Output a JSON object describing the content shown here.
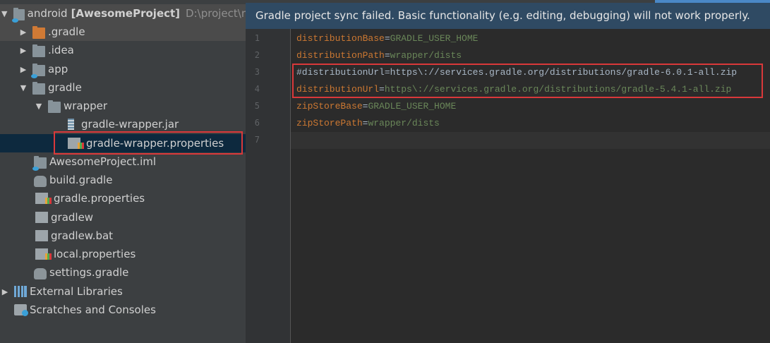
{
  "project_tree": {
    "root": {
      "name": "android",
      "module": "[AwesomeProject]",
      "path": "D:\\project\\r"
    },
    "items": [
      {
        "label": "android",
        "bold": "[AwesomeProject]",
        "path": "D:\\project\\r",
        "icon": "folder-module-icon",
        "arrow": "▼"
      },
      {
        "label": ".gradle",
        "icon": "folder-orange-icon",
        "arrow": "▶"
      },
      {
        "label": ".idea",
        "icon": "folder-icon",
        "arrow": "▶"
      },
      {
        "label": "app",
        "icon": "folder-module-icon",
        "arrow": "▶"
      },
      {
        "label": "gradle",
        "icon": "folder-icon",
        "arrow": "▼"
      },
      {
        "label": "wrapper",
        "icon": "folder-icon",
        "arrow": "▼"
      },
      {
        "label": "gradle-wrapper.jar",
        "icon": "jar-file-icon"
      },
      {
        "label": "gradle-wrapper.properties",
        "icon": "properties-file-icon"
      },
      {
        "label": "AwesomeProject.iml",
        "icon": "module-file-icon"
      },
      {
        "label": "build.gradle",
        "icon": "gradle-elephant-icon"
      },
      {
        "label": "gradle.properties",
        "icon": "properties-file-icon"
      },
      {
        "label": "gradlew",
        "icon": "text-file-icon"
      },
      {
        "label": "gradlew.bat",
        "icon": "text-file-icon"
      },
      {
        "label": "local.properties",
        "icon": "properties-file-icon"
      },
      {
        "label": "settings.gradle",
        "icon": "gradle-elephant-icon"
      },
      {
        "label": "External Libraries",
        "icon": "libraries-icon",
        "arrow": "▶"
      },
      {
        "label": "Scratches and Consoles",
        "icon": "scratches-icon"
      }
    ]
  },
  "banner": {
    "text": "Gradle project sync failed. Basic functionality (e.g. editing, debugging) will not work properly."
  },
  "editor": {
    "file": "gradle-wrapper.properties",
    "lines": [
      {
        "num": "1",
        "key": "distributionBase",
        "value": "GRADLE_USER_HOME"
      },
      {
        "num": "2",
        "key": "distributionPath",
        "value": "wrapper/dists"
      },
      {
        "num": "3",
        "comment": "#distributionUrl=https\\://services.gradle.org/distributions/gradle-6.0.1-all.zip"
      },
      {
        "num": "4",
        "key": "distributionUrl",
        "value": "https\\://services.gradle.org/distributions/gradle-5.4.1-all.zip"
      },
      {
        "num": "5",
        "key": "zipStoreBase",
        "value": "GRADLE_USER_HOME"
      },
      {
        "num": "6",
        "key": "zipStorePath",
        "value": "wrapper/dists"
      },
      {
        "num": "7",
        "key": "",
        "value": ""
      }
    ]
  },
  "colors": {
    "highlight_border": "#d9383a",
    "banner_bg": "#2f4a63",
    "key": "#cc7832",
    "value": "#6a8759"
  }
}
